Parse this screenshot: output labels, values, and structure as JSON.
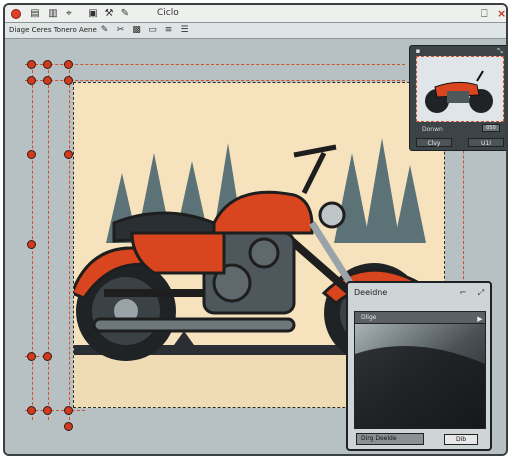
{
  "window": {
    "title": "Ciclo",
    "close_symbol": "×"
  },
  "toolbar": {
    "label": "Diage Ceres Tonero Aene",
    "icons": [
      "document-icon",
      "film-icon",
      "pin-icon",
      "tools-icon",
      "image-icon",
      "list-icon",
      "stack-icon"
    ]
  },
  "navigator": {
    "field_label": "Donwn",
    "field_value": "050",
    "button1": "Clvy",
    "button2": "U1I"
  },
  "dialog": {
    "title": "Deeidne",
    "list_header": "Dlige",
    "field_text": "Dirg Deelde",
    "ok_label": "Dib"
  },
  "colors": {
    "accent": "#d0502a",
    "artboard": "#f6e3bd",
    "canvas": "#b7c1c3",
    "motorcycle_body": "#d8451e"
  }
}
